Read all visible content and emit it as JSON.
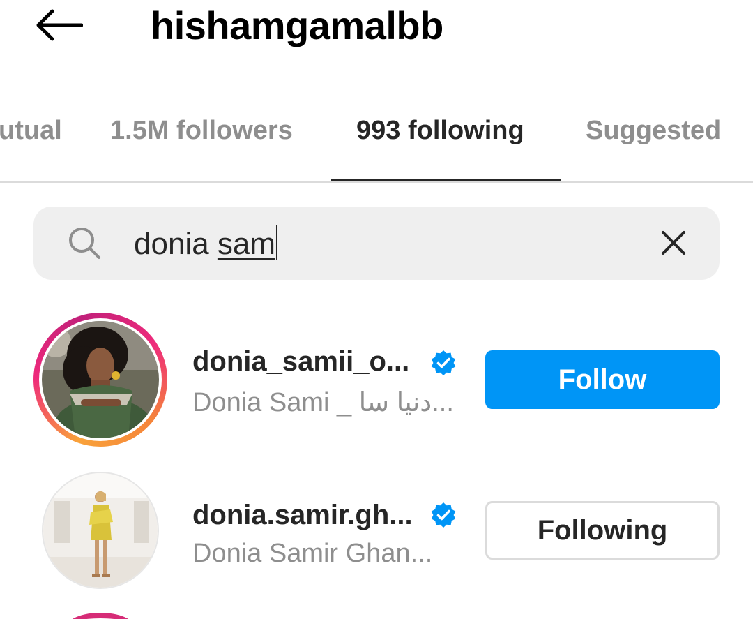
{
  "header": {
    "title": "hishamgamalbb",
    "back_icon": "arrow-left-icon"
  },
  "tabs": [
    {
      "label": "utual",
      "active": false
    },
    {
      "label": "1.5M followers",
      "active": false
    },
    {
      "label": "993 following",
      "active": true
    },
    {
      "label": "Suggested",
      "active": false
    }
  ],
  "search": {
    "committed": "donia ",
    "composing": "sam",
    "search_icon": "search-icon",
    "clear_icon": "close-icon"
  },
  "results": [
    {
      "username": "donia_samii_o...",
      "full_name": "Donia Sami _ دنيا سا...",
      "verified": true,
      "has_story": true,
      "action": "Follow"
    },
    {
      "username": "donia.samir.gh...",
      "full_name": "Donia Samir Ghan...",
      "verified": true,
      "has_story": false,
      "action": "Following"
    }
  ],
  "colors": {
    "accent": "#0095f6",
    "verified": "#0095f6",
    "muted_text": "#8e8e8e",
    "story_ring_start": "#f9a23a",
    "story_ring_end": "#c1207a"
  }
}
